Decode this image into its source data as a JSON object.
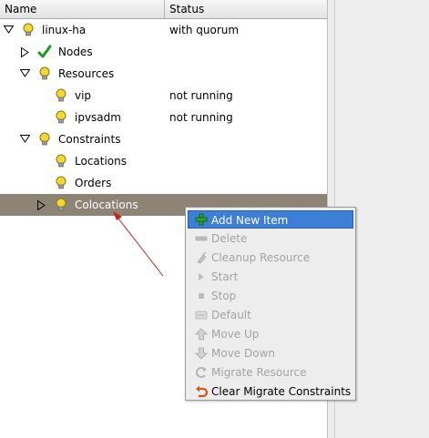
{
  "header": {
    "name_col": "Name",
    "status_col": "Status"
  },
  "tree": [
    {
      "label": "linux-ha",
      "status": "with quorum",
      "icon": "bulb-icon",
      "expander": "expanded"
    },
    {
      "label": "Nodes",
      "status": "",
      "icon": "check-icon",
      "expander": "collapsed"
    },
    {
      "label": "Resources",
      "status": "",
      "icon": "bulb-icon",
      "expander": "expanded"
    },
    {
      "label": "vip",
      "status": "not running",
      "icon": "bulb-icon",
      "expander": "none"
    },
    {
      "label": "ipvsadm",
      "status": "not running",
      "icon": "bulb-icon",
      "expander": "none"
    },
    {
      "label": "Constraints",
      "status": "",
      "icon": "bulb-icon",
      "expander": "expanded"
    },
    {
      "label": "Locations",
      "status": "",
      "icon": "bulb-icon",
      "expander": "none"
    },
    {
      "label": "Orders",
      "status": "",
      "icon": "bulb-icon",
      "expander": "none"
    },
    {
      "label": "Colocations",
      "status": "",
      "icon": "bulb-icon",
      "expander": "collapsed",
      "selected": true
    }
  ],
  "context_menu": {
    "items": [
      {
        "label": "Add New Item",
        "icon": "add-icon",
        "enabled": true,
        "highlighted": true
      },
      {
        "label": "Delete",
        "icon": "remove-icon",
        "enabled": false
      },
      {
        "label": "Cleanup Resource",
        "icon": "cleanup-icon",
        "enabled": false
      },
      {
        "label": "Start",
        "icon": "play-icon",
        "enabled": false
      },
      {
        "label": "Stop",
        "icon": "stop-icon",
        "enabled": false
      },
      {
        "label": "Default",
        "icon": "default-icon",
        "enabled": false
      },
      {
        "label": "Move Up",
        "icon": "arrow-up-icon",
        "enabled": false
      },
      {
        "label": "Move Down",
        "icon": "arrow-down-icon",
        "enabled": false
      },
      {
        "label": "Migrate Resource",
        "icon": "migrate-icon",
        "enabled": false
      },
      {
        "label": "Clear Migrate Constraints",
        "icon": "undo-icon",
        "enabled": true
      }
    ]
  },
  "colors": {
    "selection": "#8e8475",
    "menu_highlight": "#3d7ed8",
    "annotation_arrow": "#cc2020"
  }
}
